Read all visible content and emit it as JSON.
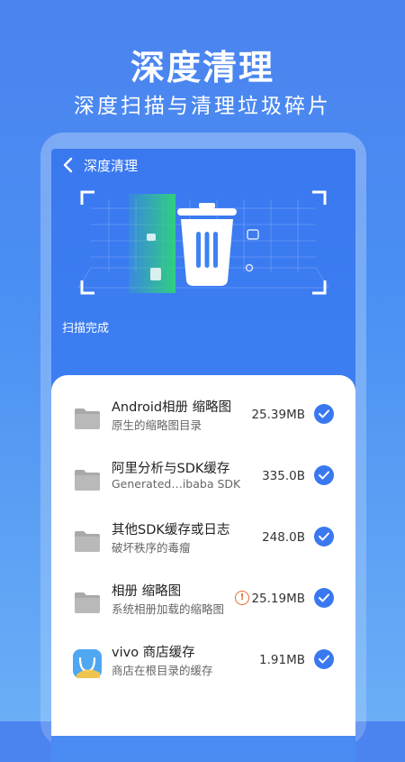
{
  "hero": {
    "title": "深度清理",
    "subtitle": "深度扫描与清理垃圾碎片"
  },
  "screen": {
    "title": "深度清理",
    "back_icon": "chevron-left-icon",
    "scan_status": "扫描完成"
  },
  "items": [
    {
      "title": "Android相册 缩略图",
      "desc": "原生的缩略图目录",
      "size": "25.39MB",
      "icon": "folder-icon",
      "checked": true,
      "warning": false
    },
    {
      "title": "阿里分析与SDK缓存",
      "desc": "Generated…ibaba SDK",
      "size": "335.0B",
      "icon": "folder-icon",
      "checked": true,
      "warning": false
    },
    {
      "title": "其他SDK缓存或日志",
      "desc": "破坏秩序的毒瘤",
      "size": "248.0B",
      "icon": "folder-icon",
      "checked": true,
      "warning": false
    },
    {
      "title": "相册 缩略图",
      "desc": "系统相册加载的缩略图",
      "size": "25.19MB",
      "icon": "folder-icon",
      "checked": true,
      "warning": true
    },
    {
      "title": "vivo 商店缓存",
      "desc": "商店在根目录的缓存",
      "size": "1.91MB",
      "icon": "vivo-store-icon",
      "checked": true,
      "warning": false
    }
  ],
  "colors": {
    "accent": "#3a78f0",
    "warning": "#e86b33",
    "scan_green": "#2fd37a"
  }
}
